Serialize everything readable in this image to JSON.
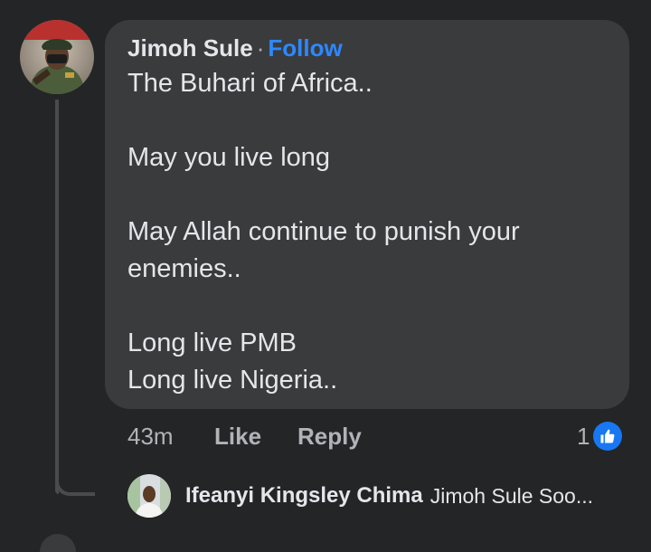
{
  "comment": {
    "author": "Jimoh Sule",
    "separator": "·",
    "follow_label": "Follow",
    "text": "The Buhari of Africa..\n\nMay you live long\n\nMay Allah continue to punish your enemies..\n\nLong live PMB\nLong live Nigeria..",
    "timestamp": "43m",
    "like_label": "Like",
    "reply_label": "Reply",
    "reaction_count": "1",
    "reaction_icon": "thumbs-up-icon"
  },
  "reply": {
    "author": "Ifeanyi Kingsley Chima",
    "preview": "Jimoh Sule Soo..."
  },
  "colors": {
    "background": "#242526",
    "bubble": "#3a3b3c",
    "text_primary": "#e4e6eb",
    "text_secondary": "#b0b3b8",
    "accent": "#2d88ff",
    "like_blue": "#1877f2"
  }
}
